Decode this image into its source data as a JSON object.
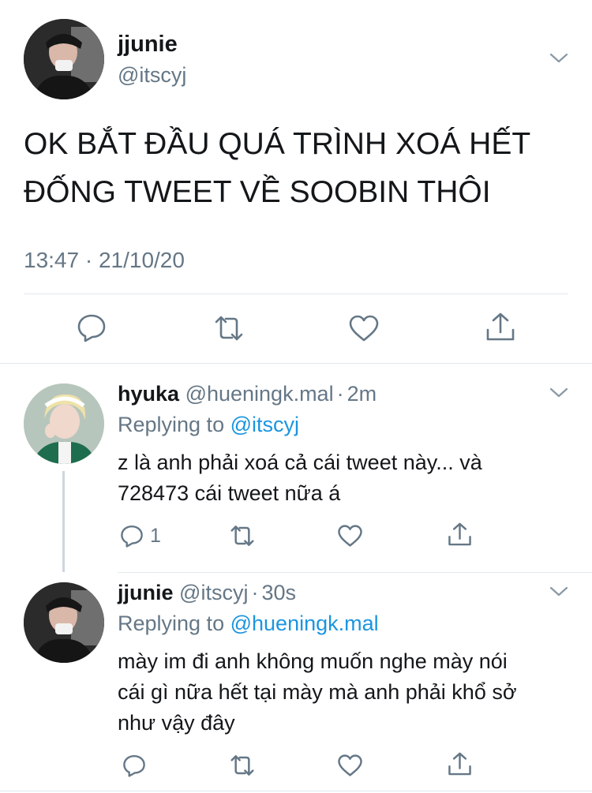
{
  "main_tweet": {
    "name": "jjunie",
    "handle": "@itscyj",
    "text_line1": "OK BẮT ĐẦU QUÁ TRÌNH XOÁ HẾT",
    "text_line2": "ĐỐNG TWEET VỀ SOOBIN THÔI",
    "timestamp": "13:47 · 21/10/20",
    "actions": [
      "reply",
      "retweet",
      "like",
      "share"
    ]
  },
  "replies": [
    {
      "name": "hyuka",
      "handle": "@hueningk.mal",
      "separator": "·",
      "time": "2m",
      "replying_prefix": "Replying to",
      "replying_to": "@itscyj",
      "text_line1": "z là anh phải xoá cả cái tweet này... và",
      "text_line2": "728473 cái tweet nữa á",
      "reply_count": "1"
    },
    {
      "name": "jjunie",
      "handle": "@itscyj",
      "separator": "·",
      "time": "30s",
      "replying_prefix": "Replying to",
      "replying_to": "@hueningk.mal",
      "text_line1": "mày im đi anh không muốn nghe mày nói",
      "text_line2": "cái gì nữa hết tại mày mà anh phải khổ sở",
      "text_line3": "như vậy đây",
      "reply_count": ""
    }
  ],
  "colors": {
    "text": "#14171a",
    "secondary": "#657786",
    "link": "#1b95e0",
    "divider": "#e1e8ed",
    "icon": "#657786"
  }
}
